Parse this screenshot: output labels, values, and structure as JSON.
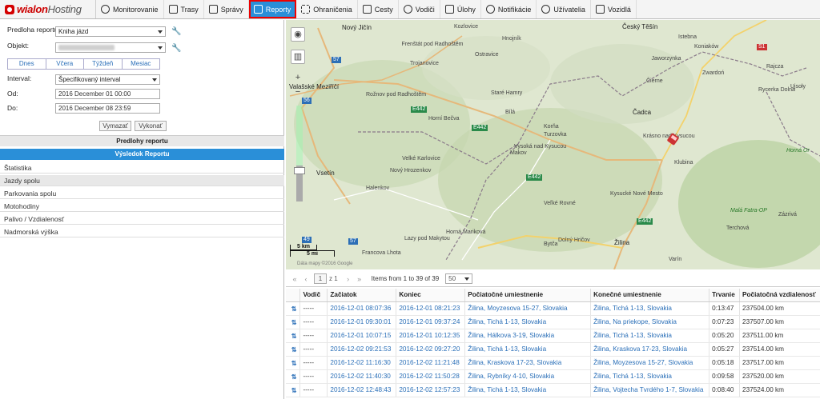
{
  "app": {
    "logo_brand": "wialon",
    "logo_suffix": "Hosting"
  },
  "nav": [
    {
      "label": "Monitorovanie",
      "icon": "globe-icon"
    },
    {
      "label": "Trasy",
      "icon": "flag-icon"
    },
    {
      "label": "Správy",
      "icon": "messages-icon"
    },
    {
      "label": "Reporty",
      "icon": "reports-icon",
      "active": true
    },
    {
      "label": "Ohraničenia",
      "icon": "geofence-icon"
    },
    {
      "label": "Cesty",
      "icon": "route-icon"
    },
    {
      "label": "Vodiči",
      "icon": "driver-icon"
    },
    {
      "label": "Úlohy",
      "icon": "tasks-icon"
    },
    {
      "label": "Notifikácie",
      "icon": "clock-icon"
    },
    {
      "label": "Užívatelia",
      "icon": "user-icon"
    },
    {
      "label": "Vozidlá",
      "icon": "bus-icon"
    }
  ],
  "form": {
    "template_label": "Predloha reportu:",
    "template_value": "Kniha jázd",
    "object_label": "Objekt:",
    "quick_tabs": [
      "Dnes",
      "Včera",
      "Týždeň",
      "Mesiac"
    ],
    "interval_label": "Interval:",
    "interval_value": "Špecifikovaný interval",
    "from_label": "Od:",
    "from_value": "2016 December 01 00:00",
    "to_label": "Do:",
    "to_value": "2016 December 08 23:59",
    "clear_label": "Vymazať",
    "execute_label": "Vykonať"
  },
  "sections": {
    "templates": "Predlohy reportu",
    "result": "Výsledok Reportu"
  },
  "result_items": [
    "Štatistika",
    "Jazdy spolu",
    "Parkovania spolu",
    "Motohodiny",
    "Palivo / Vzdialenosť",
    "Nadmorská výška"
  ],
  "map": {
    "labels": [
      "Nový Jičín",
      "Frenštát pod Radhoštěm",
      "Trojanovice",
      "Ostravice",
      "Kozlovice",
      "Hnojník",
      "Český Těšín",
      "Istebna",
      "Koniaków",
      "Jaworzynka",
      "Zwardoń",
      "Rajcza",
      "Ujsoły",
      "Rycerka Dolna",
      "Valašské Meziříčí",
      "Rožnov pod Radhoštěm",
      "Horní Bečva",
      "Staré Hamry",
      "Bílá",
      "Čierne",
      "Čadca",
      "Vsetín",
      "Velké Karlovice",
      "Vysoká nad Kysucou",
      "Turzovka",
      "Korňa",
      "Makov",
      "Krásno nad Kysucou",
      "Klubina",
      "Nový Hrozenkov",
      "Halenkov",
      "Kysucké Nové Mesto",
      "Veľké Rovné",
      "Bytča",
      "Dolný Hričov",
      "Lazy pod Makytou",
      "Horná Mariková",
      "Francova Lhota",
      "Žilina",
      "Varín",
      "Horná Or",
      "Malá Fatra-OP",
      "Zázrivá",
      "Terchová"
    ],
    "scale_km": "5 km",
    "scale_mi": "5 mi",
    "copyright": "Dáta mapy ©2016 Google",
    "roads": [
      "57",
      "56",
      "57",
      "E442",
      "E442",
      "E442",
      "49",
      "E442",
      "S1"
    ]
  },
  "pager": {
    "current": "1",
    "of_total": "z 1",
    "items_text": "Items from 1 to 39 of 39",
    "page_size": "50"
  },
  "table": {
    "columns": [
      "Vodič",
      "Začiatok",
      "Koniec",
      "Počiatočné umiestnenie",
      "Konečné umiestnenie",
      "Trvanie",
      "Počiatočná vzdialenosť"
    ],
    "rows": [
      [
        "-----",
        "2016-12-01 08:07:36",
        "2016-12-01 08:21:23",
        "Žilina, Moyzesova 15-27, Slovakia",
        "Žilina, Tichá 1-13, Slovakia",
        "0:13:47",
        "237504.00 km"
      ],
      [
        "-----",
        "2016-12-01 09:30:01",
        "2016-12-01 09:37:24",
        "Žilina, Tichá 1-13, Slovakia",
        "Žilina, Na priekope, Slovakia",
        "0:07:23",
        "237507.00 km"
      ],
      [
        "-----",
        "2016-12-01 10:07:15",
        "2016-12-01 10:12:35",
        "Žilina, Hálkova 3-19, Slovakia",
        "Žilina, Tichá 1-13, Slovakia",
        "0:05:20",
        "237511.00 km"
      ],
      [
        "-----",
        "2016-12-02 09:21:53",
        "2016-12-02 09:27:20",
        "Žilina, Tichá 1-13, Slovakia",
        "Žilina, Kraskova 17-23, Slovakia",
        "0:05:27",
        "237514.00 km"
      ],
      [
        "-----",
        "2016-12-02 11:16:30",
        "2016-12-02 11:21:48",
        "Žilina, Kraskova 17-23, Slovakia",
        "Žilina, Moyzesova 15-27, Slovakia",
        "0:05:18",
        "237517.00 km"
      ],
      [
        "-----",
        "2016-12-02 11:40:30",
        "2016-12-02 11:50:28",
        "Žilina, Rybníky 4-10, Slovakia",
        "Žilina, Tichá 1-13, Slovakia",
        "0:09:58",
        "237520.00 km"
      ],
      [
        "-----",
        "2016-12-02 12:48:43",
        "2016-12-02 12:57:23",
        "Žilina, Tichá 1-13, Slovakia",
        "Žilina, Vojtecha Tvrdého 1-7, Slovakia",
        "0:08:40",
        "237524.00 km"
      ]
    ]
  }
}
